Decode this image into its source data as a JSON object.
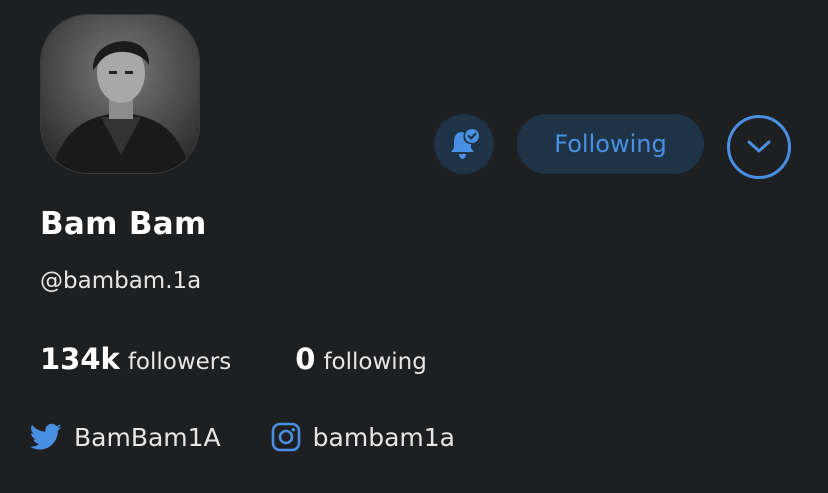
{
  "profile": {
    "display_name": "Bam Bam",
    "handle": "@bambam.1a",
    "avatar_alt": "Profile photo"
  },
  "actions": {
    "notification_icon": "bell-check-icon",
    "following_label": "Following",
    "more_icon": "chevron-down-icon"
  },
  "stats": {
    "followers_count": "134k",
    "followers_label": "followers",
    "following_count": "0",
    "following_label": "following"
  },
  "social": {
    "twitter": "BamBam1A",
    "instagram": "bambam1a"
  },
  "colors": {
    "background": "#1e1f21",
    "accent": "#4a90e2",
    "button_bg": "#1f3347"
  }
}
